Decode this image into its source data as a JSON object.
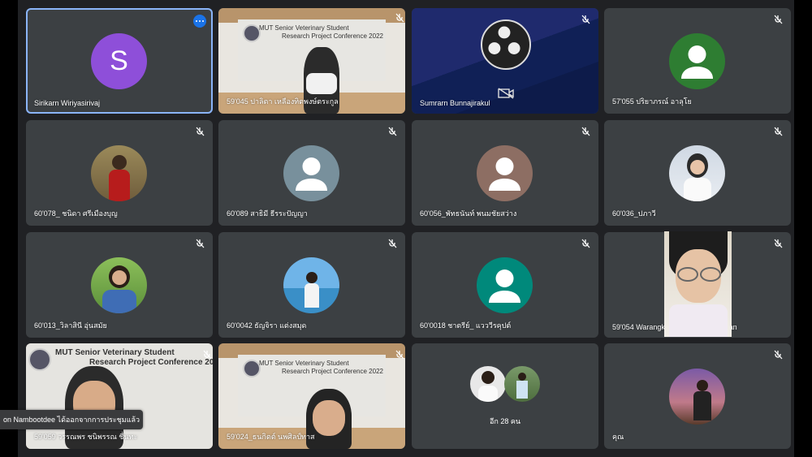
{
  "notice": "on Nambootdee ได้ออกจากการประชุมแล้ว",
  "presentation": {
    "line1": "MUT Senior Veterinary Student",
    "line2": "Research Project Conference 2022"
  },
  "participants": [
    {
      "name": "Sirikarn Wiriyasirivaj",
      "avatar_letter": "S",
      "avatar_color": "#8e4fd9"
    },
    {
      "name": "59'045 ปาลิตา เหลืองทิตพงษ์ตระกูล"
    },
    {
      "name": "Sumrarn Bunnajirakul"
    },
    {
      "name": "57'055 ปริยาภรณ์ อาลุโย"
    },
    {
      "name": "60'078_ ชนิดา ศรีเมืองบุญ"
    },
    {
      "name": "60'089 สาธิมี ธีรระปัญญา"
    },
    {
      "name": "60'056_พัทธนันท์ พนมชัยสว่าง"
    },
    {
      "name": "60'036_ปภาวี"
    },
    {
      "name": "60'013_วิลาสินี อุ่นสมัย"
    },
    {
      "name": "60'0042 ธัญจิรา แต่งสมุด"
    },
    {
      "name": "60'0018 ชาตรีย์_ แวววีรคุปต์"
    },
    {
      "name": "59'054 Warangkana Wattanakulpaisan"
    },
    {
      "name": "59'059 วรรณพร ชนิพรรณ ชื่นทะ"
    },
    {
      "name": "59'024_ธนกิตต์ นพศิลป์ทาส"
    },
    {
      "name": "อีก 28 คน"
    },
    {
      "name": "คุณ"
    }
  ]
}
